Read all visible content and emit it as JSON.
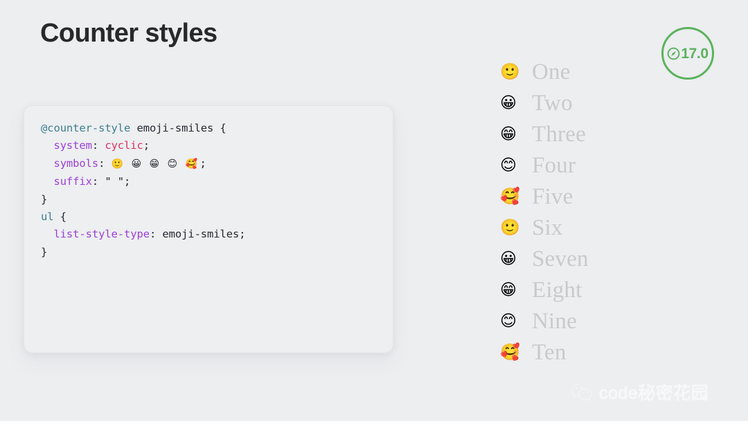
{
  "slide": {
    "title": "Counter styles",
    "background_color": "#eceef0"
  },
  "version_badge": {
    "icon": "safari-compass-icon",
    "label": "17.0",
    "color": "#5cb25d"
  },
  "code_card": {
    "language": "css",
    "background_color": "#edeff1",
    "lines": [
      {
        "indent": 0,
        "tokens": [
          {
            "type": "atrule",
            "text": "@counter-style"
          },
          {
            "type": "plain",
            "text": " emoji-smiles {"
          }
        ]
      },
      {
        "indent": 1,
        "tokens": [
          {
            "type": "prop",
            "text": "system"
          },
          {
            "type": "plain",
            "text": ": "
          },
          {
            "type": "value",
            "text": "cyclic"
          },
          {
            "type": "plain",
            "text": ";"
          }
        ]
      },
      {
        "indent": 1,
        "tokens": [
          {
            "type": "prop",
            "text": "symbols"
          },
          {
            "type": "plain",
            "text": ": "
          },
          {
            "type": "emoji",
            "text": "🙂 😀 😁 😊 🥰"
          },
          {
            "type": "plain",
            "text": ";"
          }
        ]
      },
      {
        "indent": 1,
        "tokens": [
          {
            "type": "prop",
            "text": "suffix"
          },
          {
            "type": "plain",
            "text": ": \" \";"
          }
        ]
      },
      {
        "indent": 0,
        "tokens": [
          {
            "type": "plain",
            "text": "}"
          }
        ]
      },
      {
        "indent": 0,
        "tokens": [
          {
            "type": "selector",
            "text": "ul"
          },
          {
            "type": "plain",
            "text": " {"
          }
        ]
      },
      {
        "indent": 1,
        "tokens": [
          {
            "type": "prop",
            "text": "list-style-type"
          },
          {
            "type": "plain",
            "text": ": emoji-smiles;"
          }
        ]
      },
      {
        "indent": 0,
        "tokens": [
          {
            "type": "plain",
            "text": "}"
          }
        ]
      }
    ],
    "syntax_colors": {
      "atrule": "#3d7e8d",
      "selector": "#3d7e8d",
      "property": "#9b3fd4",
      "value": "#e0315e",
      "plain": "#24292e"
    }
  },
  "demo_list": {
    "text_color": "#c8cacc",
    "items": [
      {
        "marker": "🙂",
        "label": "One"
      },
      {
        "marker": "😀",
        "label": "Two"
      },
      {
        "marker": "😁",
        "label": "Three"
      },
      {
        "marker": "😊",
        "label": "Four"
      },
      {
        "marker": "🥰",
        "label": "Five"
      },
      {
        "marker": "🙂",
        "label": "Six"
      },
      {
        "marker": "😀",
        "label": "Seven"
      },
      {
        "marker": "😁",
        "label": "Eight"
      },
      {
        "marker": "😊",
        "label": "Nine"
      },
      {
        "marker": "🥰",
        "label": "Ten"
      }
    ]
  },
  "watermark": {
    "icon": "wechat-icon",
    "text": "code秘密花园"
  }
}
